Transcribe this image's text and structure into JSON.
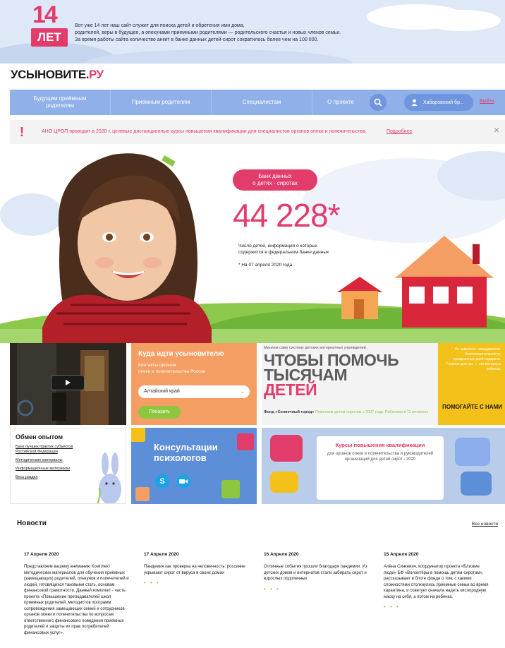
{
  "anniversary": {
    "number": "14",
    "word": "ЛЕТ",
    "line1": "Вот уже 14 лет наш сайт служит для поиска детей и обретения ими дома,",
    "line2": "родителей, веры в будущее, а опекунами приемными родителями — родительского счастья и новых членов семьи.",
    "line3": "За время работы сайта количество анкет в банке данных детей-сирот сократилось более чем на 100 000."
  },
  "site": {
    "name": "УСЫНОВИТЕ.",
    "tld": "РУ"
  },
  "nav": {
    "items": [
      {
        "label": "Будущим приёмным родителям"
      },
      {
        "label": "Приёмным родителям"
      },
      {
        "label": "Специалистам"
      },
      {
        "label": "О проекте"
      }
    ],
    "user": "Хабаровский бр...",
    "logout": "Выйти"
  },
  "notice": {
    "mark": "!",
    "text": "АНО ЦРОП проводит в 2020 г. целевые дистанционные курсы повышения квалификации для специалистов органов опеки и попечительства.",
    "more": "Подробнее",
    "close": "×"
  },
  "hero": {
    "badge_line1": "Банк данных",
    "badge_line2": "о детях - сиротах",
    "count": "44 228*",
    "description": "Число детей, информация о которых содержится в федеральном банке данных",
    "date": "* На 07 апреля 2020 года"
  },
  "tiles": {
    "where": {
      "title": "Куда идти усыновителю",
      "subtitle_line1": "Контакты органов",
      "subtitle_line2": "опеки и попечительства России",
      "region": "Алтайский край",
      "button": "Показать"
    },
    "help": {
      "caption": "Меняем саму систему детских интернатных учреждений.",
      "line1": "ЧТОБЫ ПОМОЧЬ",
      "line2": "ТЫСЯЧАМ",
      "line3": "ДЕТЕЙ",
      "fund": "Фонд «Солнечный город»",
      "fund_note": "Помогаем детям-сиротам с 2007 года. Работаем в 11 регионах",
      "right_text": "Не замечено «мандаринов» благотворительности, праздничных дней подарков. Главное для нас — это интересы ребенка.",
      "right_button": "ПОМОГАЙТЕ С НАМИ"
    },
    "exchange": {
      "title": "Обмен опытом",
      "links": [
        "Банк лучших практик субъектов Российской Федерации",
        "Методические материалы",
        "Информационные материалы",
        "Весь раздел"
      ]
    },
    "psychologists": {
      "title_line1": "Консультации",
      "title_line2": "психологов",
      "skype": "S"
    },
    "courses": {
      "title": "Курсы повышения квалификации",
      "body": "для органов опеки и попечительства и руководителей организаций для детей сирот - 2020"
    }
  },
  "news": {
    "title": "Новости",
    "all": "Все новости",
    "items": [
      {
        "date": "17 Апреля 2020",
        "text": "Представляем вашему вниманию Комплект методических материалов для обучения приёмных (замещающих) родителей, опекунов и попечителей и людей, готовящихся таковыми стать, основам финансовой грамотности. Данный комплект - часть проекта «Повышение преподавателей школ приемных родителей, методистов программ сопровождения замещающих семей и сотрудников органов опеки и попечительства по вопросам ответственного финансового поведения приемных родителей и защиты их прав потребителей финансовых услуг»."
      },
      {
        "date": "17 Апреля 2020",
        "text": "Пандемия как проверка на человечность: россияне укрывают сирот от вируса в своих домах"
      },
      {
        "date": "16 Апреля 2020",
        "text": "Отличные события прошли благодаря пандемии. Из детских домов и интернатов стали забирать сирот и взрослых подопечных"
      },
      {
        "date": "15 Апреля 2020",
        "text": "Алёна Синкевич, координатор проекта «Близкие люди» БФ «Волонтёры в помощь детям-сиротам», рассказывает в блоге фонда о том, с какими сложностями столкнулись приемные семьи во время карантина, и советует сначала надеть кислородную маску на себя, а потом на ребенка."
      }
    ],
    "dots": "• • •"
  },
  "colors": {
    "brand_pink": "#e23c6b",
    "nav_blue": "#8fb0e8",
    "orange": "#f59e63",
    "green": "#8dc63f",
    "yellow": "#f4c11a"
  }
}
